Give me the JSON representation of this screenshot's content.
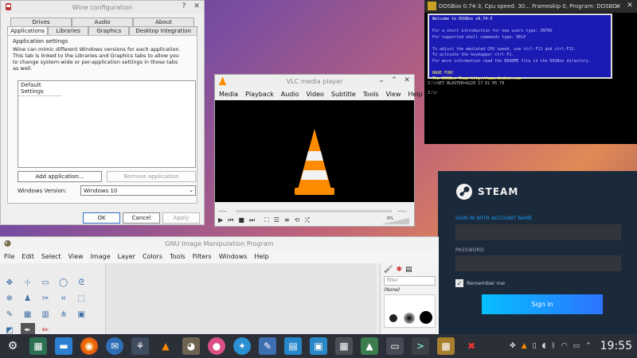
{
  "wine": {
    "title": "Wine configuration",
    "tabs_row1": [
      "Drives",
      "Audio",
      "About"
    ],
    "tabs_row2": [
      "Applications",
      "Libraries",
      "Graphics",
      "Desktop Integration"
    ],
    "group_title": "Application settings",
    "description": "Wine can mimic different Windows versions for each application. This tab is linked to the Libraries and Graphics tabs to allow you to change system-wide or per-application settings in those tabs as well.",
    "list_item": "Default Settings",
    "add_button": "Add application...",
    "remove_button": "Remove application",
    "version_label": "Windows Version:",
    "version_value": "Windows 10",
    "ok": "OK",
    "cancel": "Cancel",
    "apply": "Apply"
  },
  "vlc": {
    "title": "VLC media player",
    "menu": [
      "Media",
      "Playback",
      "Audio",
      "Video",
      "Subtitle",
      "Tools",
      "View",
      "Help"
    ],
    "time_left": "--:--",
    "time_right": "--:--",
    "volume": "0%"
  },
  "dosbox": {
    "title": "DOSBox 0.74-3, Cpu speed: 30... Frameskip 0, Program: DOSBOX",
    "welcome": "Welcome to DOSBox v0.74-3",
    "lines": [
      "For a short introduction for new users type: INTRO",
      "For supported shell commands type: HELP",
      "",
      "To adjust the emulated CPU speed, use ctrl-F11 and ctrl-F12.",
      "To activate the keymapper ctrl-F1.",
      "For more information read the README file in the DOSBox directory.",
      "",
      "HAVE FUN!",
      "The DOSBox Team http://www.dosbox.com"
    ],
    "prompt1": "Z:\\>SET BLASTER=A220 I7 D1 H5 T6",
    "prompt2": "Z:\\>"
  },
  "steam": {
    "brand": "STEAM",
    "signin_label": "SIGN IN WITH ACCOUNT NAME",
    "password_label": "PASSWORD",
    "remember": "Remember me",
    "signin_button": "Sign in"
  },
  "gimp": {
    "title": "GNU Image Manipulation Program",
    "menu": [
      "File",
      "Edit",
      "Select",
      "View",
      "Image",
      "Layer",
      "Colors",
      "Tools",
      "Filters",
      "Windows",
      "Help"
    ],
    "filter_placeholder": "filter",
    "brush_none": "(None)"
  },
  "taskbar": {
    "clock": "19:55"
  },
  "colors": {
    "steam_accent": "#1a9fff",
    "steam_button": "#1a8fe8",
    "dos_blue": "#1b1bb3",
    "vlc_orange": "#ff8c00"
  }
}
